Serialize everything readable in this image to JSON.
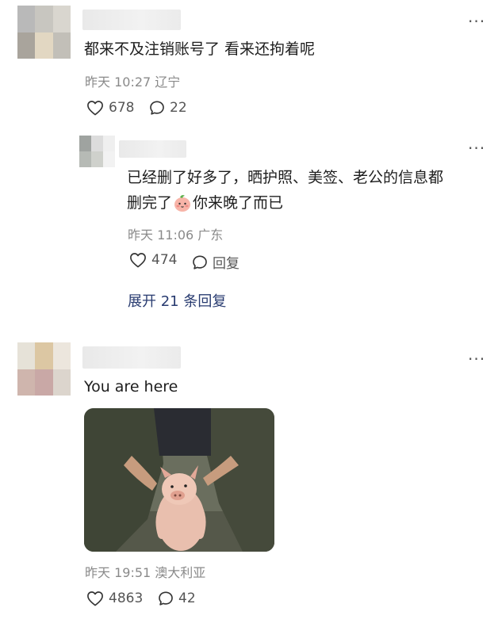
{
  "comments": [
    {
      "text": "都来不及注销账号了 看来还拘着呢",
      "time": "昨天 10:27",
      "location": "辽宁",
      "likes": "678",
      "replies": "22",
      "more": "···"
    },
    {
      "text_line1": "已经删了好多了，晒护照、美签、老公的信息都",
      "text_line2_a": "删完了",
      "text_line2_b": "你来晚了而已",
      "time": "昨天 11:06",
      "location": "广东",
      "likes": "474",
      "reply_label": "回复",
      "more": "···",
      "expand_label": "展开 21 条回复"
    },
    {
      "text": "You are here",
      "time": "昨天 19:51",
      "location": "澳大利亚",
      "likes": "4863",
      "replies": "42",
      "more": "···"
    }
  ],
  "icons": {
    "like": "heart-outline-icon",
    "comment": "speech-bubble-icon",
    "emoji": "peach-face-emoji"
  },
  "colors": {
    "text": "#1e1e1e",
    "meta": "#8a8a8a",
    "expand_link": "#283b70"
  }
}
